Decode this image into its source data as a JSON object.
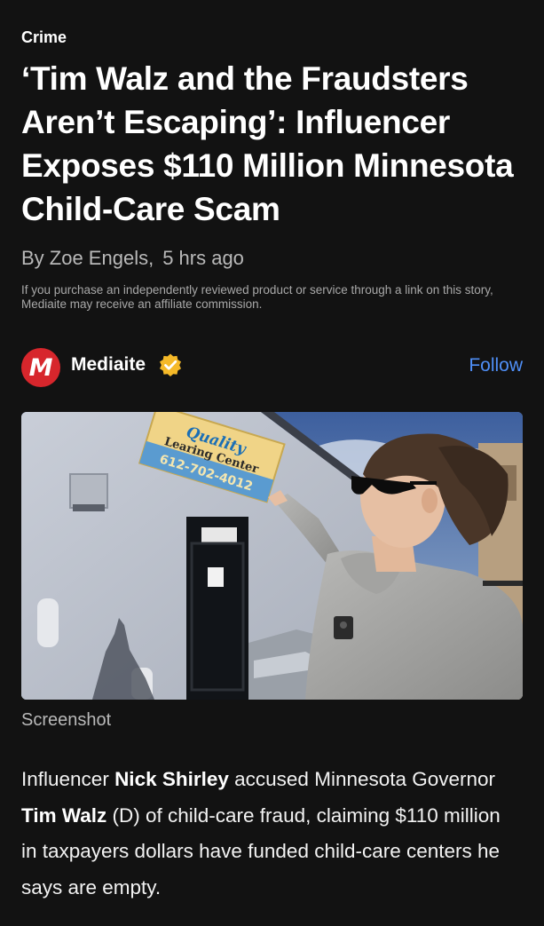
{
  "article": {
    "category": "Crime",
    "headline": "‘Tim Walz and the Fraudsters Aren’t Escaping’: Influencer Exposes $110 Million Minnesota Child-Care Scam",
    "author": "By Zoe Engels,",
    "time": "5 hrs ago",
    "disclosure": "If you purchase an independently reviewed product or service through a link on this story, Mediaite may receive an affiliate commission."
  },
  "publisher": {
    "logo_letter": "M",
    "name": "Mediaite",
    "follow_label": "Follow",
    "brand_color": "#d7262c",
    "follow_color": "#4f8ff7",
    "verified_icon": "verified-badge-icon"
  },
  "image": {
    "sign_line1": "Quality",
    "sign_line2": "Learing Center",
    "sign_phone": "612-702-4012",
    "caption": "Screenshot"
  },
  "body": {
    "p1": "Influencer ",
    "name1": "Nick Shirley",
    "p2": " accused Minnesota Governor ",
    "name2": "Tim Walz",
    "p3": " (D) of child-care fraud, claiming $110 million in taxpayers dollars have funded child-care centers he says are empty."
  }
}
